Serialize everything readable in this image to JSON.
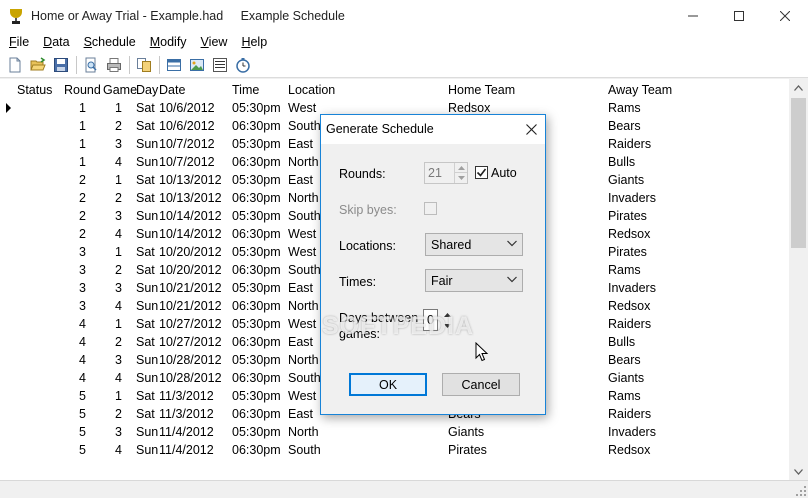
{
  "window": {
    "title": "Home or Away Trial - Example.had     Example Schedule",
    "controls": [
      "minimize",
      "maximize",
      "close"
    ]
  },
  "menu": {
    "items": [
      {
        "mnemonic": "F",
        "rest": "ile"
      },
      {
        "mnemonic": "D",
        "rest": "ata"
      },
      {
        "mnemonic": "S",
        "rest": "chedule"
      },
      {
        "mnemonic": "M",
        "rest": "odify"
      },
      {
        "mnemonic": "V",
        "rest": "iew"
      },
      {
        "mnemonic": "H",
        "rest": "elp"
      }
    ]
  },
  "toolbar": {
    "icons": [
      "new-file-icon",
      "open-folder-icon",
      "save-icon",
      "print-preview-icon",
      "print-icon",
      "copy-icon",
      "columns-icon",
      "image-icon",
      "list-icon",
      "timer-icon"
    ]
  },
  "table": {
    "headers": {
      "status": "Status",
      "round": "Round",
      "game": "Game",
      "day": "Day",
      "date": "Date",
      "time": "Time",
      "location": "Location",
      "home": "Home Team",
      "away": "Away Team"
    },
    "rows": [
      {
        "round": "1",
        "game": "1",
        "day": "Sat",
        "date": "10/6/2012",
        "time": "05:30pm",
        "location": "West",
        "home": "Redsox",
        "away": "Rams"
      },
      {
        "round": "1",
        "game": "2",
        "day": "Sat",
        "date": "10/6/2012",
        "time": "06:30pm",
        "location": "South",
        "home": "",
        "away": "Bears"
      },
      {
        "round": "1",
        "game": "3",
        "day": "Sun",
        "date": "10/7/2012",
        "time": "05:30pm",
        "location": "East",
        "home": "",
        "away": "Raiders"
      },
      {
        "round": "1",
        "game": "4",
        "day": "Sun",
        "date": "10/7/2012",
        "time": "06:30pm",
        "location": "North",
        "home": "",
        "away": "Bulls"
      },
      {
        "round": "2",
        "game": "1",
        "day": "Sat",
        "date": "10/13/2012",
        "time": "05:30pm",
        "location": "East",
        "home": "",
        "away": "Giants"
      },
      {
        "round": "2",
        "game": "2",
        "day": "Sat",
        "date": "10/13/2012",
        "time": "06:30pm",
        "location": "North",
        "home": "",
        "away": "Invaders"
      },
      {
        "round": "2",
        "game": "3",
        "day": "Sun",
        "date": "10/14/2012",
        "time": "05:30pm",
        "location": "South",
        "home": "",
        "away": "Pirates"
      },
      {
        "round": "2",
        "game": "4",
        "day": "Sun",
        "date": "10/14/2012",
        "time": "06:30pm",
        "location": "West",
        "home": "",
        "away": "Redsox"
      },
      {
        "round": "3",
        "game": "1",
        "day": "Sat",
        "date": "10/20/2012",
        "time": "05:30pm",
        "location": "West",
        "home": "",
        "away": "Pirates"
      },
      {
        "round": "3",
        "game": "2",
        "day": "Sat",
        "date": "10/20/2012",
        "time": "06:30pm",
        "location": "South",
        "home": "",
        "away": "Rams"
      },
      {
        "round": "3",
        "game": "3",
        "day": "Sun",
        "date": "10/21/2012",
        "time": "05:30pm",
        "location": "East",
        "home": "",
        "away": "Invaders"
      },
      {
        "round": "3",
        "game": "4",
        "day": "Sun",
        "date": "10/21/2012",
        "time": "06:30pm",
        "location": "North",
        "home": "",
        "away": "Redsox"
      },
      {
        "round": "4",
        "game": "1",
        "day": "Sat",
        "date": "10/27/2012",
        "time": "05:30pm",
        "location": "West",
        "home": "",
        "away": "Raiders"
      },
      {
        "round": "4",
        "game": "2",
        "day": "Sat",
        "date": "10/27/2012",
        "time": "06:30pm",
        "location": "East",
        "home": "",
        "away": "Bulls"
      },
      {
        "round": "4",
        "game": "3",
        "day": "Sun",
        "date": "10/28/2012",
        "time": "05:30pm",
        "location": "North",
        "home": "",
        "away": "Bears"
      },
      {
        "round": "4",
        "game": "4",
        "day": "Sun",
        "date": "10/28/2012",
        "time": "06:30pm",
        "location": "South",
        "home": "",
        "away": "Giants"
      },
      {
        "round": "5",
        "game": "1",
        "day": "Sat",
        "date": "11/3/2012",
        "time": "05:30pm",
        "location": "West",
        "home": "",
        "away": "Rams"
      },
      {
        "round": "5",
        "game": "2",
        "day": "Sat",
        "date": "11/3/2012",
        "time": "06:30pm",
        "location": "East",
        "home": "Bears",
        "away": "Raiders"
      },
      {
        "round": "5",
        "game": "3",
        "day": "Sun",
        "date": "11/4/2012",
        "time": "05:30pm",
        "location": "North",
        "home": "Giants",
        "away": "Invaders"
      },
      {
        "round": "5",
        "game": "4",
        "day": "Sun",
        "date": "11/4/2012",
        "time": "06:30pm",
        "location": "South",
        "home": "Pirates",
        "away": "Redsox"
      }
    ]
  },
  "dialog": {
    "title": "Generate Schedule",
    "rounds_label": "Rounds:",
    "rounds_value": "21",
    "auto_label": "Auto",
    "auto_checked": true,
    "skip_byes_label": "Skip byes:",
    "locations_label": "Locations:",
    "locations_value": "Shared",
    "times_label": "Times:",
    "times_value": "Fair",
    "days_label_line1": "Days between",
    "days_label_line2": "games:",
    "days_value": "0",
    "ok_label": "OK",
    "cancel_label": "Cancel"
  },
  "watermark": "SOFTPEDIA",
  "colors": {
    "accent": "#0078d7",
    "dialog_border": "#1883d7"
  }
}
